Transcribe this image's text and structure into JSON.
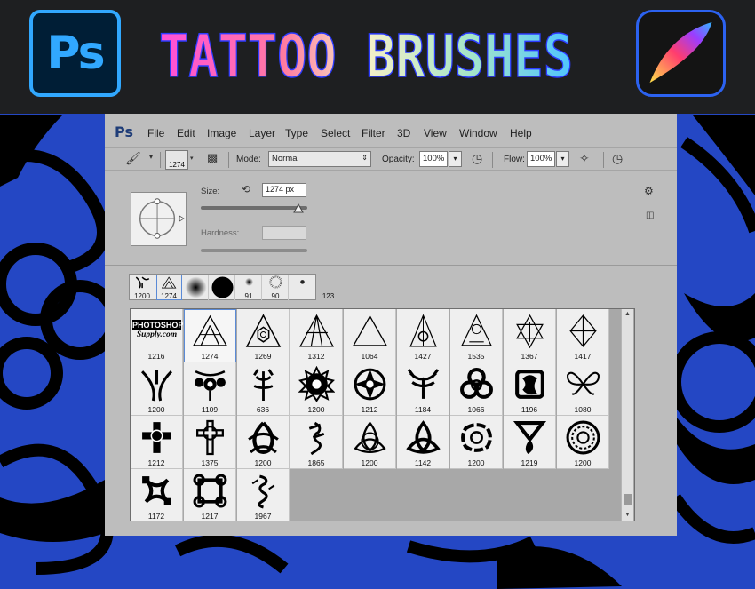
{
  "banner": {
    "ps_logo_text": "Ps",
    "title": "TATTOO BRUSHES"
  },
  "menubar": {
    "app": "Ps",
    "items": [
      "File",
      "Edit",
      "Image",
      "Layer",
      "Type",
      "Select",
      "Filter",
      "3D",
      "View",
      "Window",
      "Help"
    ]
  },
  "options": {
    "brush_size": "1274",
    "mode_label": "Mode:",
    "mode_value": "Normal",
    "opacity_label": "Opacity:",
    "opacity_value": "100%",
    "flow_label": "Flow:",
    "flow_value": "100%"
  },
  "brush_panel": {
    "size_label": "Size:",
    "size_value": "1274 px",
    "hardness_label": "Hardness:"
  },
  "recent_brushes": [
    "1200",
    "1274",
    "",
    "",
    "91",
    "90",
    "123"
  ],
  "presets": [
    "1216",
    "1274",
    "1269",
    "1312",
    "1064",
    "1427",
    "1535",
    "1367",
    "1417",
    "1200",
    "1109",
    "636",
    "1200",
    "1212",
    "1184",
    "1066",
    "1196",
    "1080",
    "1212",
    "1375",
    "1200",
    "1865",
    "1200",
    "1142",
    "1200",
    "1219",
    "1200",
    "1172",
    "1217",
    "1967"
  ],
  "first_preset_text": [
    "PHOTOSHOP",
    "Supply.com"
  ],
  "colors": {
    "background_blue": "#2447c4",
    "banner_dark": "#1e1f21",
    "ps_blue": "#31a8ff",
    "panel_gray": "#bdbdbd"
  }
}
